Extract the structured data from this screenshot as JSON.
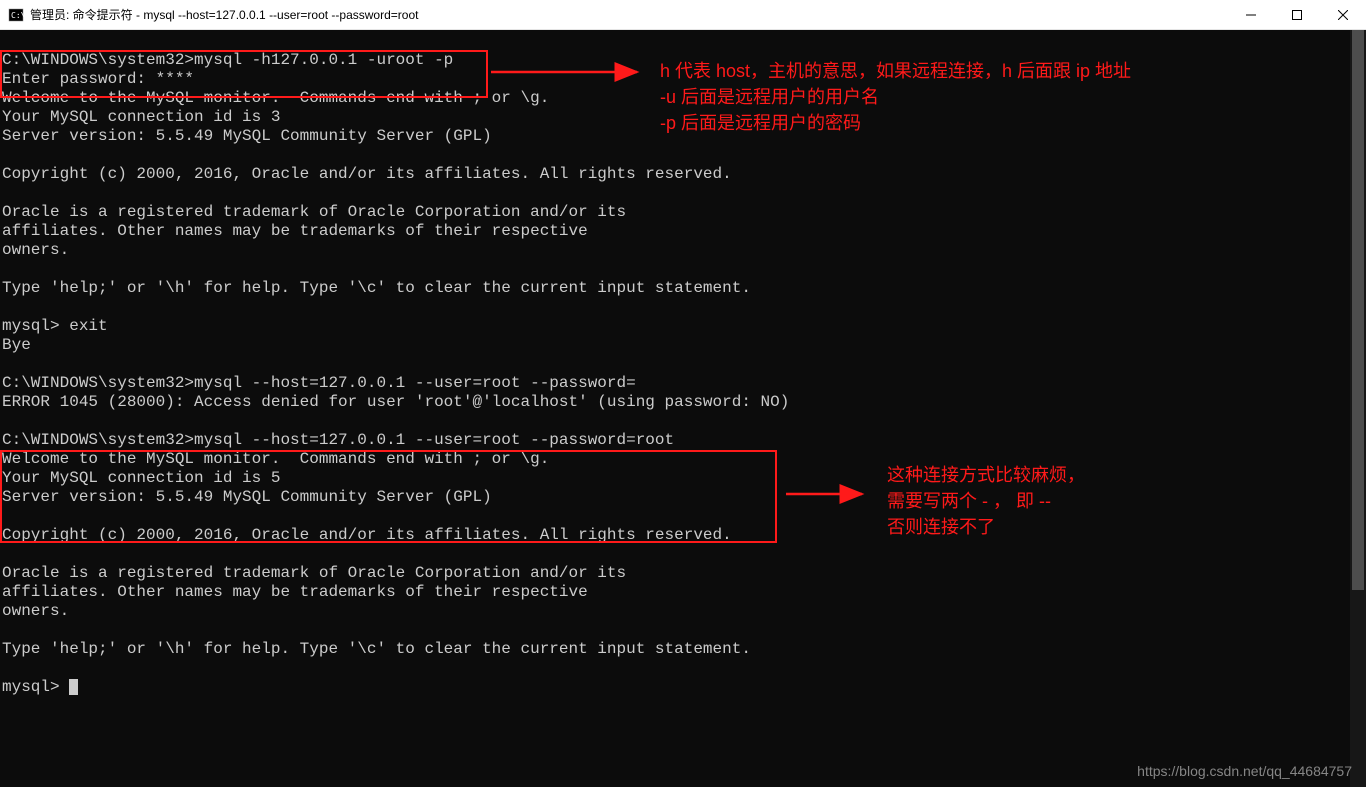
{
  "window": {
    "title": "管理员: 命令提示符 - mysql  --host=127.0.0.1 --user=root --password=root"
  },
  "terminal": {
    "lines": [
      "",
      "C:\\WINDOWS\\system32>mysql -h127.0.0.1 -uroot -p",
      "Enter password: ****",
      "Welcome to the MySQL monitor.  Commands end with ; or \\g.",
      "Your MySQL connection id is 3",
      "Server version: 5.5.49 MySQL Community Server (GPL)",
      "",
      "Copyright (c) 2000, 2016, Oracle and/or its affiliates. All rights reserved.",
      "",
      "Oracle is a registered trademark of Oracle Corporation and/or its",
      "affiliates. Other names may be trademarks of their respective",
      "owners.",
      "",
      "Type 'help;' or '\\h' for help. Type '\\c' to clear the current input statement.",
      "",
      "mysql> exit",
      "Bye",
      "",
      "C:\\WINDOWS\\system32>mysql --host=127.0.0.1 --user=root --password=",
      "ERROR 1045 (28000): Access denied for user 'root'@'localhost' (using password: NO)",
      "",
      "C:\\WINDOWS\\system32>mysql --host=127.0.0.1 --user=root --password=root",
      "Welcome to the MySQL monitor.  Commands end with ; or \\g.",
      "Your MySQL connection id is 5",
      "Server version: 5.5.49 MySQL Community Server (GPL)",
      "",
      "Copyright (c) 2000, 2016, Oracle and/or its affiliates. All rights reserved.",
      "",
      "Oracle is a registered trademark of Oracle Corporation and/or its",
      "affiliates. Other names may be trademarks of their respective",
      "owners.",
      "",
      "Type 'help;' or '\\h' for help. Type '\\c' to clear the current input statement.",
      "",
      "mysql> "
    ]
  },
  "annotations": {
    "a1_line1": "h 代表 host，主机的意思，如果远程连接，h 后面跟 ip 地址",
    "a1_line2": "-u 后面是远程用户的用户名",
    "a1_line3": "-p 后面是远程用户的密码",
    "a2_line1": "这种连接方式比较麻烦，",
    "a2_line2": "需要写两个 - ， 即 --",
    "a2_line3": "否则连接不了"
  },
  "watermark": "https://blog.csdn.net/qq_44684757"
}
